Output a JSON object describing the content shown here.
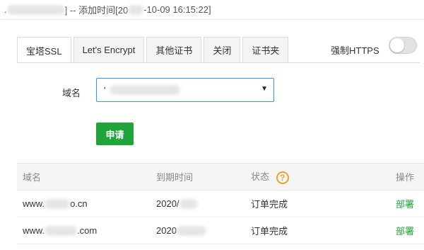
{
  "window": {
    "title_prefix": ".",
    "title_mid": "] -- 添加时间[20",
    "title_suffix": "-10-09 16:15:22]"
  },
  "tabs": [
    {
      "label": "宝塔SSL",
      "active": true
    },
    {
      "label": "Let's Encrypt",
      "active": false
    },
    {
      "label": "其他证书",
      "active": false
    },
    {
      "label": "关闭",
      "active": false
    },
    {
      "label": "证书夹",
      "active": false
    }
  ],
  "force_https": {
    "label": "强制HTTPS",
    "enabled": false
  },
  "form": {
    "domain_label": "域名",
    "domain_value": "'",
    "apply_label": "申请"
  },
  "table": {
    "headers": {
      "domain": "域名",
      "expiry": "到期时间",
      "status": "状态",
      "action": "操作"
    },
    "rows": [
      {
        "domain_prefix": "www.",
        "domain_suffix": "o.cn",
        "expiry": "2020/",
        "status": "订单完成",
        "action": "部署"
      },
      {
        "domain_prefix": "www.",
        "domain_suffix": ".com",
        "expiry": "2020",
        "status": "订单完成",
        "action": "部署"
      }
    ]
  },
  "colors": {
    "accent_green": "#20a53a",
    "select_border": "#2a9cff",
    "help_orange": "#f0a12a"
  }
}
